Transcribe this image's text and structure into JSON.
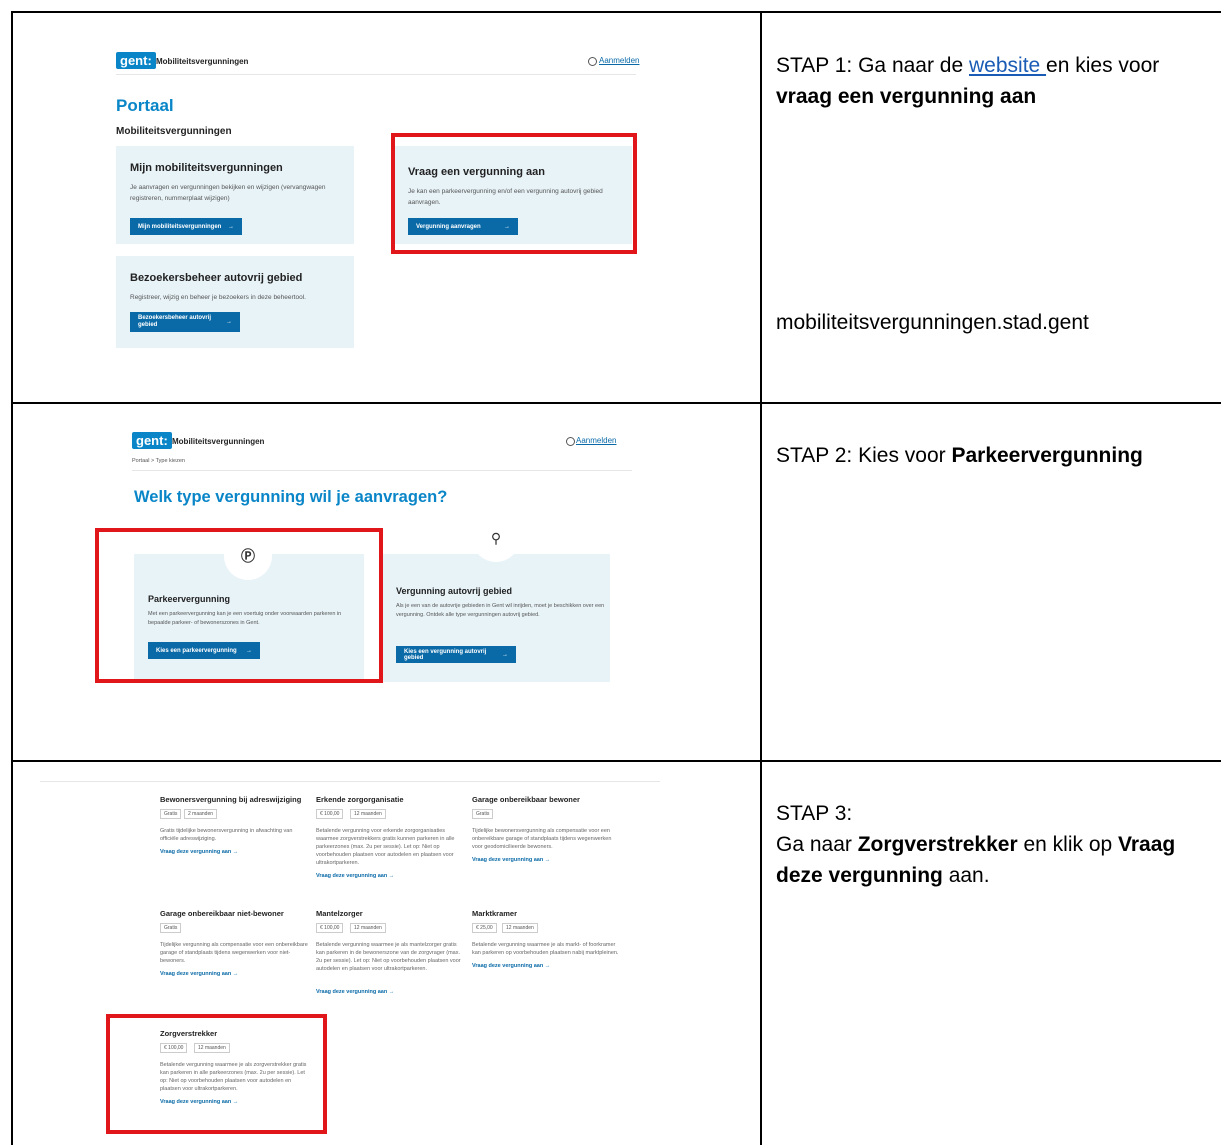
{
  "rows": [
    {
      "step_prefix": "STAP 1: Ga naar de ",
      "link_text": "website ",
      "step_mid": " en kies voor ",
      "step_bold": "vraag een vergunning aan",
      "url": "mobiliteitsvergunningen.stad.gent",
      "screenshot": {
        "logo": "gent:",
        "app_title": "Mobiliteitsvergunningen",
        "login": "Aanmelden",
        "page_title": "Portaal",
        "subtitle": "Mobiliteitsvergunningen",
        "cards": [
          {
            "title": "Mijn mobiliteitsvergunningen",
            "desc": "Je aanvragen en vergunningen bekijken en wijzigen (vervangwagen registreren, nummerplaat wijzigen)",
            "button": "Mijn mobiliteitsvergunningen"
          },
          {
            "title": "Vraag een vergunning aan",
            "desc": "Je kan een parkeervergunning en/of een vergunning autovrij gebied aanvragen.",
            "button": "Vergunning aanvragen"
          },
          {
            "title": "Bezoekersbeheer autovrij gebied",
            "desc": "Registreer, wijzig en beheer je bezoekers in deze beheertool.",
            "button": "Bezoekersbeheer autovrij gebied"
          }
        ]
      }
    },
    {
      "step_prefix": "STAP 2: Kies voor ",
      "step_bold": "Parkeervergunning",
      "screenshot": {
        "logo": "gent:",
        "app_title": "Mobiliteitsvergunningen",
        "login": "Aanmelden",
        "breadcrumb": "Portaal  >  Type kiezen",
        "heading": "Welk type vergunning wil je aanvragen?",
        "cards": [
          {
            "title": "Parkeervergunning",
            "desc": "Met een parkeervergunning kan je een voertuig onder voorwaarden parkeren in bepaalde parkeer- of bewonerszones in Gent.",
            "button": "Kies een parkeervergunning",
            "icon": "parking-car-icon"
          },
          {
            "title": "Vergunning autovrij gebied",
            "desc": "Als je een van de autovrije gebieden in Gent wil inrijden, moet je beschikken over een vergunning. Ontdek alle type vergunningen autovrij gebied.",
            "button": "Kies een vergunning autovrij gebied",
            "icon": "search-car-icon"
          }
        ]
      }
    },
    {
      "step_line1": "STAP 3:",
      "step_prefix": "Ga naar ",
      "step_bold1": "Zorgverstrekker",
      "step_mid": " en klik op ",
      "step_bold2": "Vraag deze vergunning",
      "step_suffix": " aan.",
      "screenshot": {
        "permits": [
          {
            "title": "Bewonersvergunning bij adreswijziging",
            "tags": [
              "Gratis",
              "2 maanden"
            ],
            "desc": "Gratis tijdelijke bewonersvergunning in afwachting van officiële adreswijziging.",
            "link": "Vraag deze vergunning aan"
          },
          {
            "title": "Erkende zorgorganisatie",
            "tags": [
              "€ 100,00",
              "12 maanden"
            ],
            "desc": "Betalende vergunning voor erkende zorgorganisaties waarmee zorgverstrekkers gratis kunnen parkeren in alle parkeerzones (max. 2u per sessie). Let op: Niet op voorbehouden plaatsen voor autodelen en plaatsen voor ultrakortparkeren.",
            "link": "Vraag deze vergunning aan"
          },
          {
            "title": "Garage onbereikbaar bewoner",
            "tags": [
              "Gratis"
            ],
            "desc": "Tijdelijke bewonersvergunning als compensatie voor een onbereikbare garage of standplaats tijdens wegenwerken voor geodomicilieerde bewoners.",
            "link": "Vraag deze vergunning aan"
          },
          {
            "title": "Garage onbereikbaar niet-bewoner",
            "tags": [
              "Gratis"
            ],
            "desc": "Tijdelijke vergunning als compensatie voor een onbereikbare garage of standplaats tijdens wegenwerken voor niet-bewoners.",
            "link": "Vraag deze vergunning aan"
          },
          {
            "title": "Mantelzorger",
            "tags": [
              "€ 100,00",
              "12 maanden"
            ],
            "desc": "Betalende vergunning waarmee je als mantelzorger gratis kan parkeren in de bewonerszone van de zorgvrager (max. 2u per sessie). Let op: Niet op voorbehouden plaatsen voor autodelen en plaatsen voor ultrakortparkeren.",
            "link": "Vraag deze vergunning aan"
          },
          {
            "title": "Marktkramer",
            "tags": [
              "€ 25,00",
              "12 maanden"
            ],
            "desc": "Betalende vergunning waarmee je als markt- of foorkramer kan parkeren op voorbehouden plaatsen nabij marktpleinen.",
            "link": "Vraag deze vergunning aan"
          },
          {
            "title": "Zorgverstrekker",
            "tags": [
              "€ 100,00",
              "12 maanden"
            ],
            "desc": "Betalende vergunning waarmee je als zorgverstrekker gratis kan parkeren in alle parkeerzones (max. 2u per sessie). Let op: Niet op voorbehouden plaatsen voor autodelen en plaatsen voor ultrakortparkeren.",
            "link": "Vraag deze vergunning aan"
          }
        ]
      }
    }
  ],
  "colors": {
    "accent": "#0a86c8",
    "button": "#0a6aa8",
    "card": "#e8f3f8",
    "highlight": "#e0161b",
    "link": "#1a5bb5"
  }
}
